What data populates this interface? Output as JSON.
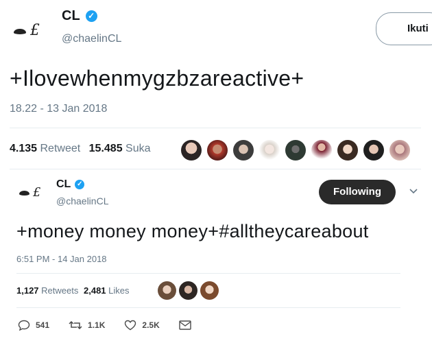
{
  "tweet1": {
    "name": "CL",
    "handle": "@chaelinCL",
    "follow_label": "Ikuti",
    "text": "+Ilovewhenmygzbzareactive+",
    "timestamp": "18.22 - 13 Jan 2018",
    "retweet_count": "4.135",
    "retweet_label": "Retweet",
    "like_count": "15.485",
    "like_label": "Suka"
  },
  "tweet2": {
    "name": "CL",
    "handle": "@chaelinCL",
    "following_label": "Following",
    "text": "+money money money+#alltheycareabout",
    "timestamp": "6:51 PM - 14 Jan 2018",
    "retweet_count": "1,127",
    "retweet_label": "Retweets",
    "like_count": "2,481",
    "like_label": "Likes",
    "actions": {
      "reply_count": "541",
      "retweet_count": "1.1K",
      "like_count": "2.5K"
    }
  },
  "colors": {
    "verified": "#1da1f2",
    "following_button": "#2a2a2a",
    "divider": "#e6ecf0"
  }
}
